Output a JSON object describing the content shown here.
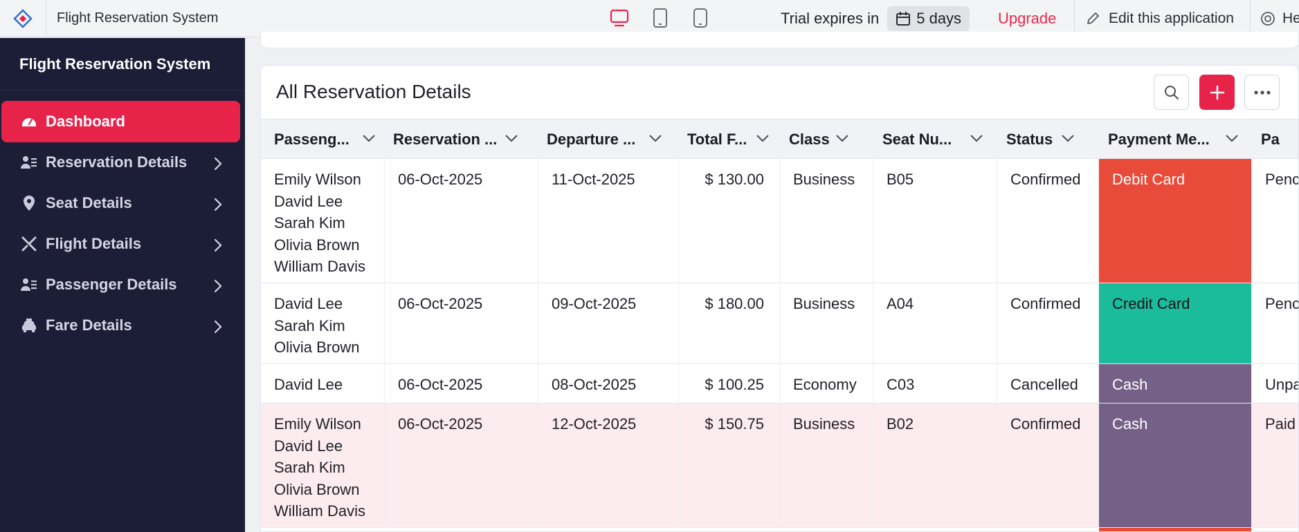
{
  "topbar": {
    "app_title": "Flight Reservation System",
    "trial_label": "Trial expires in",
    "trial_days": "5 days",
    "upgrade": "Upgrade",
    "edit_app": "Edit this application",
    "help": "He"
  },
  "sidebar": {
    "title": "Flight Reservation System",
    "items": [
      {
        "label": "Dashboard",
        "icon": "gauge-icon"
      },
      {
        "label": "Reservation Details",
        "icon": "user-list-icon"
      },
      {
        "label": "Seat Details",
        "icon": "map-pin-icon"
      },
      {
        "label": "Flight Details",
        "icon": "plane-icon"
      },
      {
        "label": "Passenger Details",
        "icon": "user-list-icon"
      },
      {
        "label": "Fare Details",
        "icon": "taxi-icon"
      }
    ]
  },
  "main": {
    "title": "All Reservation Details",
    "columns": [
      "Passeng...",
      "Reservation ...",
      "Departure ...",
      "Total F...",
      "Class",
      "Seat Nu...",
      "Status",
      "Payment Me...",
      "Pa"
    ],
    "rows": [
      {
        "passengers": [
          "Emily Wilson",
          "David Lee",
          "Sarah Kim",
          "Olivia Brown",
          "William Davis"
        ],
        "reservation_date": "06-Oct-2025",
        "departure_date": "11-Oct-2025",
        "total_fare": "$ 130.00",
        "class": "Business",
        "seat": "B05",
        "status": "Confirmed",
        "payment_method": "Debit Card",
        "payment_color": "#e84b3a",
        "payment_status": "Penc"
      },
      {
        "passengers": [
          "David Lee",
          "Sarah Kim",
          "Olivia Brown"
        ],
        "reservation_date": "06-Oct-2025",
        "departure_date": "09-Oct-2025",
        "total_fare": "$ 180.00",
        "class": "Business",
        "seat": "A04",
        "status": "Confirmed",
        "payment_method": "Credit Card",
        "payment_color": "#1bbc9b",
        "payment_status": "Penc"
      },
      {
        "passengers": [
          "David Lee"
        ],
        "reservation_date": "06-Oct-2025",
        "departure_date": "08-Oct-2025",
        "total_fare": "$ 100.25",
        "class": "Economy",
        "seat": "C03",
        "status": "Cancelled",
        "payment_method": "Cash",
        "payment_color": "#756187",
        "payment_status": "Unpa"
      },
      {
        "passengers": [
          "Emily Wilson",
          "David Lee",
          "Sarah Kim",
          "Olivia Brown",
          "William Davis"
        ],
        "reservation_date": "06-Oct-2025",
        "departure_date": "12-Oct-2025",
        "total_fare": "$ 150.75",
        "class": "Business",
        "seat": "B02",
        "status": "Confirmed",
        "payment_method": "Cash",
        "payment_color": "#756187",
        "payment_status": "Paid"
      }
    ]
  },
  "colors": {
    "accent": "#e8234a",
    "sidebar_bg": "#1c1d36",
    "highlight_row": "#fdecef"
  }
}
